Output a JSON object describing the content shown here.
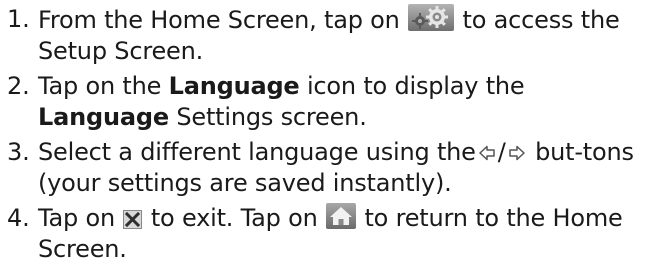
{
  "steps": [
    {
      "num": "1.",
      "t1": "From the Home Screen, tap on",
      "t2": "to access the Setup Screen.",
      "icon": "setup-gear-icon"
    },
    {
      "num": "2.",
      "t1": "Tap on the",
      "b1": "Language",
      "t2": "icon to display the",
      "b2": "Language",
      "t3": "Settings screen."
    },
    {
      "num": "3.",
      "t1": "Select a different language using the",
      "sep": "/",
      "t2": "but-tons (your settings are saved instantly).",
      "icons": [
        "arrow-left-icon",
        "arrow-right-icon"
      ]
    },
    {
      "num": "4.",
      "t1": "Tap on",
      "t2": "to exit. Tap on",
      "t3": "to return to the Home Screen.",
      "icons": [
        "close-x-icon",
        "home-icon"
      ]
    }
  ],
  "colors": {
    "text": "#1a1a1a",
    "icon_gray": "#8c8c8c",
    "icon_dark": "#3a3a3a"
  }
}
